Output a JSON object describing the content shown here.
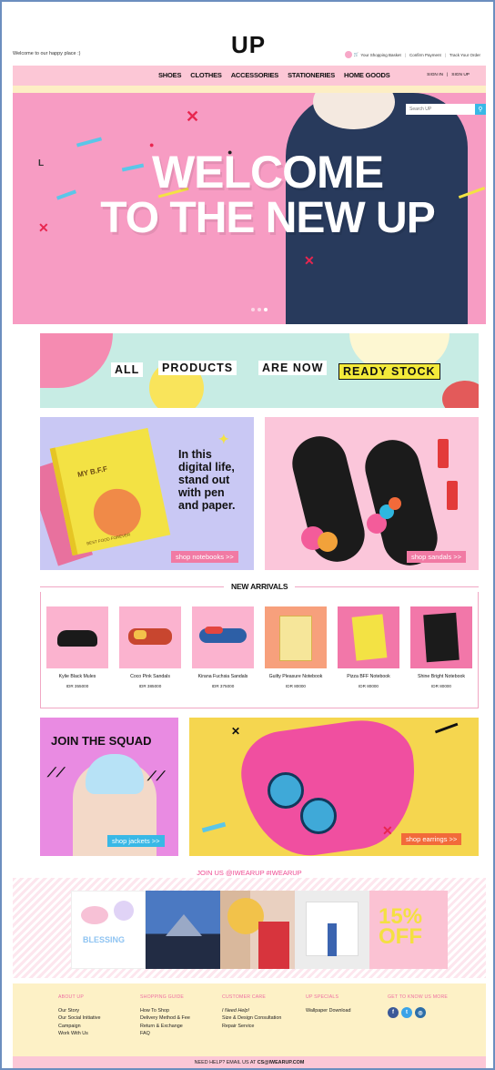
{
  "header": {
    "welcome": "Welcome to our happy place :)",
    "logo": "UP",
    "cart_label": "Your Shopping Basket",
    "confirm_payment": "Confirm Payment",
    "track_order": "Track Your Order"
  },
  "nav": {
    "items": [
      "SHOES",
      "CLOTHES",
      "ACCESSORIES",
      "STATIONERIES",
      "HOME GOODS"
    ],
    "sign_in": "SIGN IN",
    "divider": "|",
    "sign_up": "SIGN UP"
  },
  "hero": {
    "line1": "WELCOME",
    "line2": "TO THE NEW UP",
    "search_placeholder": "Search UP",
    "slides": 3,
    "active_slide": 2
  },
  "banner": {
    "w1": "ALL",
    "w2": "PRODUCTS",
    "w3": "ARE NOW",
    "w4": "READY STOCK"
  },
  "promos": {
    "notebook_copy": "In this digital life, stand out with pen and paper.",
    "notebook_cover": "MY B.F.F",
    "notebook_cover_sub": "BEST FOOD FOREVER",
    "notebook_cta": "shop notebooks >>",
    "sandal_cta": "shop sandals >>",
    "squad_title": "JOIN THE SQUAD",
    "jacket_cta": "shop jackets >>",
    "earring_cta": "shop earrings >>"
  },
  "new_arrivals": {
    "title": "NEW ARRIVALS",
    "products": [
      {
        "name": "Kylie Black Mules",
        "price": "IDR 355000"
      },
      {
        "name": "Coco Pink Sandals",
        "price": "IDR 385000"
      },
      {
        "name": "Kirana Fuchsia Sandals",
        "price": "IDR 375000"
      },
      {
        "name": "Guilty Pleasure Notebook",
        "price": "IDR 80000"
      },
      {
        "name": "Pizza BFF Notebook",
        "price": "IDR 80000"
      },
      {
        "name": "Shine Bright Notebook",
        "price": "IDR 80000"
      }
    ]
  },
  "instagram": {
    "join": "JOIN US @IWEARUP #IWEARUP",
    "promo_pct": "15%",
    "promo_off": "OFF",
    "blessing": "BLESSING"
  },
  "footer": {
    "about": {
      "heading": "ABOUT UP",
      "items": [
        "Our Story",
        "Our Social Initiative",
        "Campaign",
        "Work With Us"
      ]
    },
    "shopping": {
      "heading": "SHOPPING GUIDE",
      "items": [
        "How To Shop",
        "Delivery Method & Fee",
        "Return & Exchange",
        "FAQ"
      ]
    },
    "care": {
      "heading": "CUSTOMER CARE",
      "items": [
        "I Need Help!",
        "Size & Design Consultation",
        "Repair Service"
      ]
    },
    "specials": {
      "heading": "UP SPECIALS",
      "items": [
        "Wallpaper Download"
      ]
    },
    "social": {
      "heading": "GET TO KNOW US MORE"
    },
    "help_prefix": "NEED HELP? EMAIL US AT",
    "help_email": "CS@IWEARUP.COM"
  },
  "colors": {
    "pink": "#f79cc3",
    "nav_pink": "#fcc7d6",
    "accent_pink": "#ee4b92",
    "cream": "#fdf1c6",
    "cyan": "#39b8e6"
  }
}
